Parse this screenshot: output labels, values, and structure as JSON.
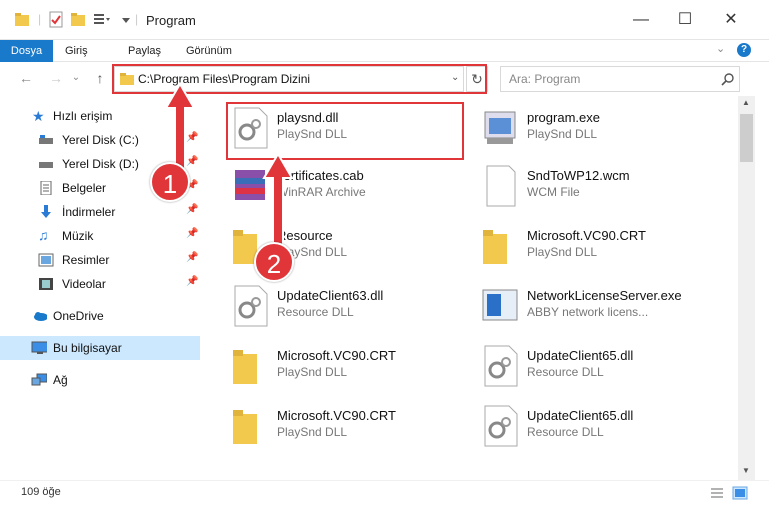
{
  "window": {
    "title": "Program"
  },
  "ribbon": {
    "tabs": [
      "Dosya",
      "Giriş",
      "Paylaş",
      "Görünüm"
    ]
  },
  "address": {
    "path": "C:\\Program Files\\Program Dizini"
  },
  "search": {
    "placeholder": "Ara: Program"
  },
  "sidebar": {
    "items": [
      {
        "label": "Hızlı erişim"
      },
      {
        "label": "Yerel Disk (C:)"
      },
      {
        "label": "Yerel Disk (D:)"
      },
      {
        "label": "Belgeler"
      },
      {
        "label": "İndirmeler"
      },
      {
        "label": "Müzik"
      },
      {
        "label": "Resimler"
      },
      {
        "label": "Videolar"
      },
      {
        "label": "OneDrive"
      },
      {
        "label": "Bu bilgisayar"
      },
      {
        "label": "Ağ"
      }
    ]
  },
  "files": [
    {
      "name": "playsnd.dll",
      "type": "PlaySnd DLL",
      "icon": "dll-gear-icon"
    },
    {
      "name": "program.exe",
      "type": "PlaySnd DLL",
      "icon": "exe-icon"
    },
    {
      "name": "certificates.cab",
      "type": "WinRAR Archive",
      "icon": "winrar-icon"
    },
    {
      "name": "SndToWP12.wcm",
      "type": "WCM File",
      "icon": "blank-file-icon"
    },
    {
      "name": "Resource",
      "type": "PlaySnd DLL",
      "icon": "folder-icon"
    },
    {
      "name": "Microsoft.VC90.CRT",
      "type": "PlaySnd DLL",
      "icon": "folder-icon"
    },
    {
      "name": "UpdateClient63.dll",
      "type": "Resource DLL",
      "icon": "dll-gear-icon"
    },
    {
      "name": "NetworkLicenseServer.exe",
      "type": "ABBY network licens...",
      "icon": "exe-icon"
    },
    {
      "name": "Microsoft.VC90.CRT",
      "type": "PlaySnd DLL",
      "icon": "folder-icon"
    },
    {
      "name": "UpdateClient65.dll",
      "type": "Resource DLL",
      "icon": "dll-gear-icon"
    },
    {
      "name": "Microsoft.VC90.CRT",
      "type": "PlaySnd DLL",
      "icon": "folder-icon"
    },
    {
      "name": "UpdateClient65.dll",
      "type": "Resource DLL",
      "icon": "dll-gear-icon"
    }
  ],
  "status": {
    "count": "109 öğe"
  },
  "callouts": [
    "1",
    "2"
  ],
  "colors": {
    "accent": "#1979ca",
    "highlight": "#e0363a",
    "selected": "#cce8ff"
  }
}
